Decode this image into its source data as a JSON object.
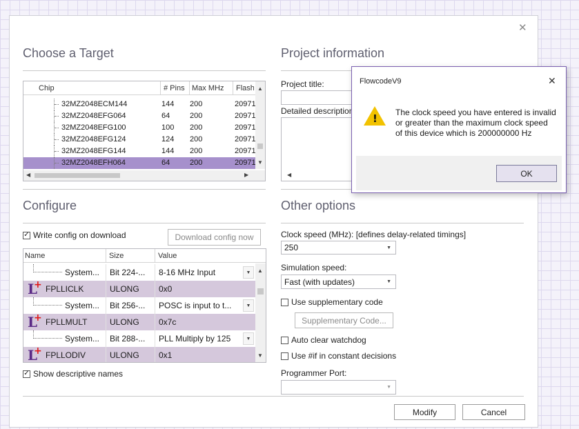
{
  "choose_target": {
    "title": "Choose a Target",
    "columns": [
      "Chip",
      "# Pins",
      "Max MHz",
      "Flash"
    ],
    "rows": [
      {
        "chip": "32MZ2048ECM144",
        "pins": "144",
        "mhz": "200",
        "flash": "20971",
        "selected": false
      },
      {
        "chip": "32MZ2048EFG064",
        "pins": "64",
        "mhz": "200",
        "flash": "20971",
        "selected": false
      },
      {
        "chip": "32MZ2048EFG100",
        "pins": "100",
        "mhz": "200",
        "flash": "20971",
        "selected": false
      },
      {
        "chip": "32MZ2048EFG124",
        "pins": "124",
        "mhz": "200",
        "flash": "20971",
        "selected": false
      },
      {
        "chip": "32MZ2048EFG144",
        "pins": "144",
        "mhz": "200",
        "flash": "20971",
        "selected": false
      },
      {
        "chip": "32MZ2048EFH064",
        "pins": "64",
        "mhz": "200",
        "flash": "20971",
        "selected": true
      }
    ]
  },
  "project_info": {
    "title": "Project information",
    "project_title_label": "Project title:",
    "project_title_value": "",
    "description_label": "Detailed description:",
    "description_value": ""
  },
  "configure": {
    "title": "Configure",
    "write_config_label": "Write config on download",
    "write_config_checked": true,
    "download_button": "Download config now",
    "columns": [
      "Name",
      "Size",
      "Value"
    ],
    "rows": [
      {
        "type": "child",
        "name": "System...",
        "size": "Bit 224-...",
        "value": "8-16 MHz Input",
        "has_dropdown": true
      },
      {
        "type": "group",
        "name": "FPLLICLK",
        "size": "ULONG",
        "value": "0x0",
        "has_dropdown": false
      },
      {
        "type": "child",
        "name": "System...",
        "size": "Bit 256-...",
        "value": "POSC is input to t...",
        "has_dropdown": true
      },
      {
        "type": "group",
        "name": "FPLLMULT",
        "size": "ULONG",
        "value": "0x7c",
        "has_dropdown": false
      },
      {
        "type": "child",
        "name": "System...",
        "size": "Bit 288-...",
        "value": "PLL Multiply by 125",
        "has_dropdown": true
      },
      {
        "type": "group",
        "name": "FPLLODIV",
        "size": "ULONG",
        "value": "0x1",
        "has_dropdown": false
      }
    ],
    "show_names_label": "Show descriptive names",
    "show_names_checked": true
  },
  "other_options": {
    "title": "Other options",
    "clock_label": "Clock speed (MHz): [defines delay-related timings]",
    "clock_value": "250",
    "sim_label": "Simulation speed:",
    "sim_value": "Fast (with updates)",
    "supp_code_label": "Use supplementary code",
    "supp_code_button": "Supplementary Code...",
    "watchdog_label": "Auto clear watchdog",
    "ifdef_label": "Use #if in constant decisions",
    "programmer_label": "Programmer Port:",
    "programmer_value": ""
  },
  "footer": {
    "modify_button": "Modify",
    "cancel_button": "Cancel"
  },
  "message_box": {
    "title": "FlowcodeV9",
    "line1": "The clock speed you have entered is invalid",
    "line2": "or greater than the maximum clock speed",
    "line3": "of this device which is 200000000 Hz",
    "ok_button": "OK"
  },
  "icons": {
    "close": "close-icon",
    "warning": "warning-icon",
    "config_group": "config-l-icon"
  },
  "colors": {
    "selected_row": "#a690cc",
    "group_row": "#d5c8dc",
    "accent_border": "#7a5fb0",
    "warning": "#f2c200"
  }
}
